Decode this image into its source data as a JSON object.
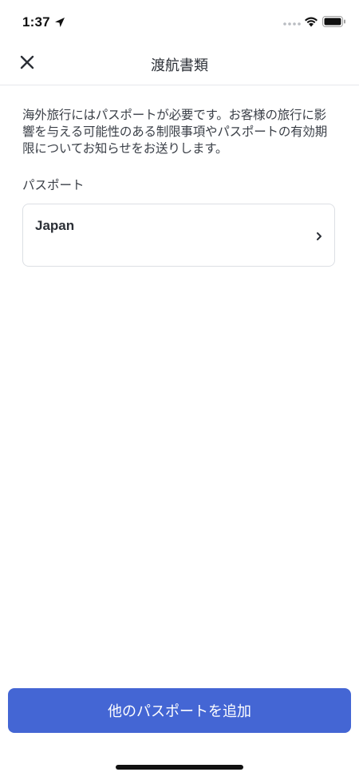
{
  "status_bar": {
    "time": "1:37"
  },
  "header": {
    "title": "渡航書類"
  },
  "main": {
    "description": "海外旅行にはパスポートが必要です。お客様の旅行に影響を与える可能性のある制限事項やパスポートの有効期限についてお知らせをお送りします。",
    "section_label": "パスポート",
    "passports": [
      {
        "country": "Japan"
      }
    ]
  },
  "footer": {
    "add_button_label": "他のパスポートを追加"
  },
  "colors": {
    "primary": "#4466d4",
    "text": "#2b2f36",
    "border": "#dcdfe4"
  }
}
